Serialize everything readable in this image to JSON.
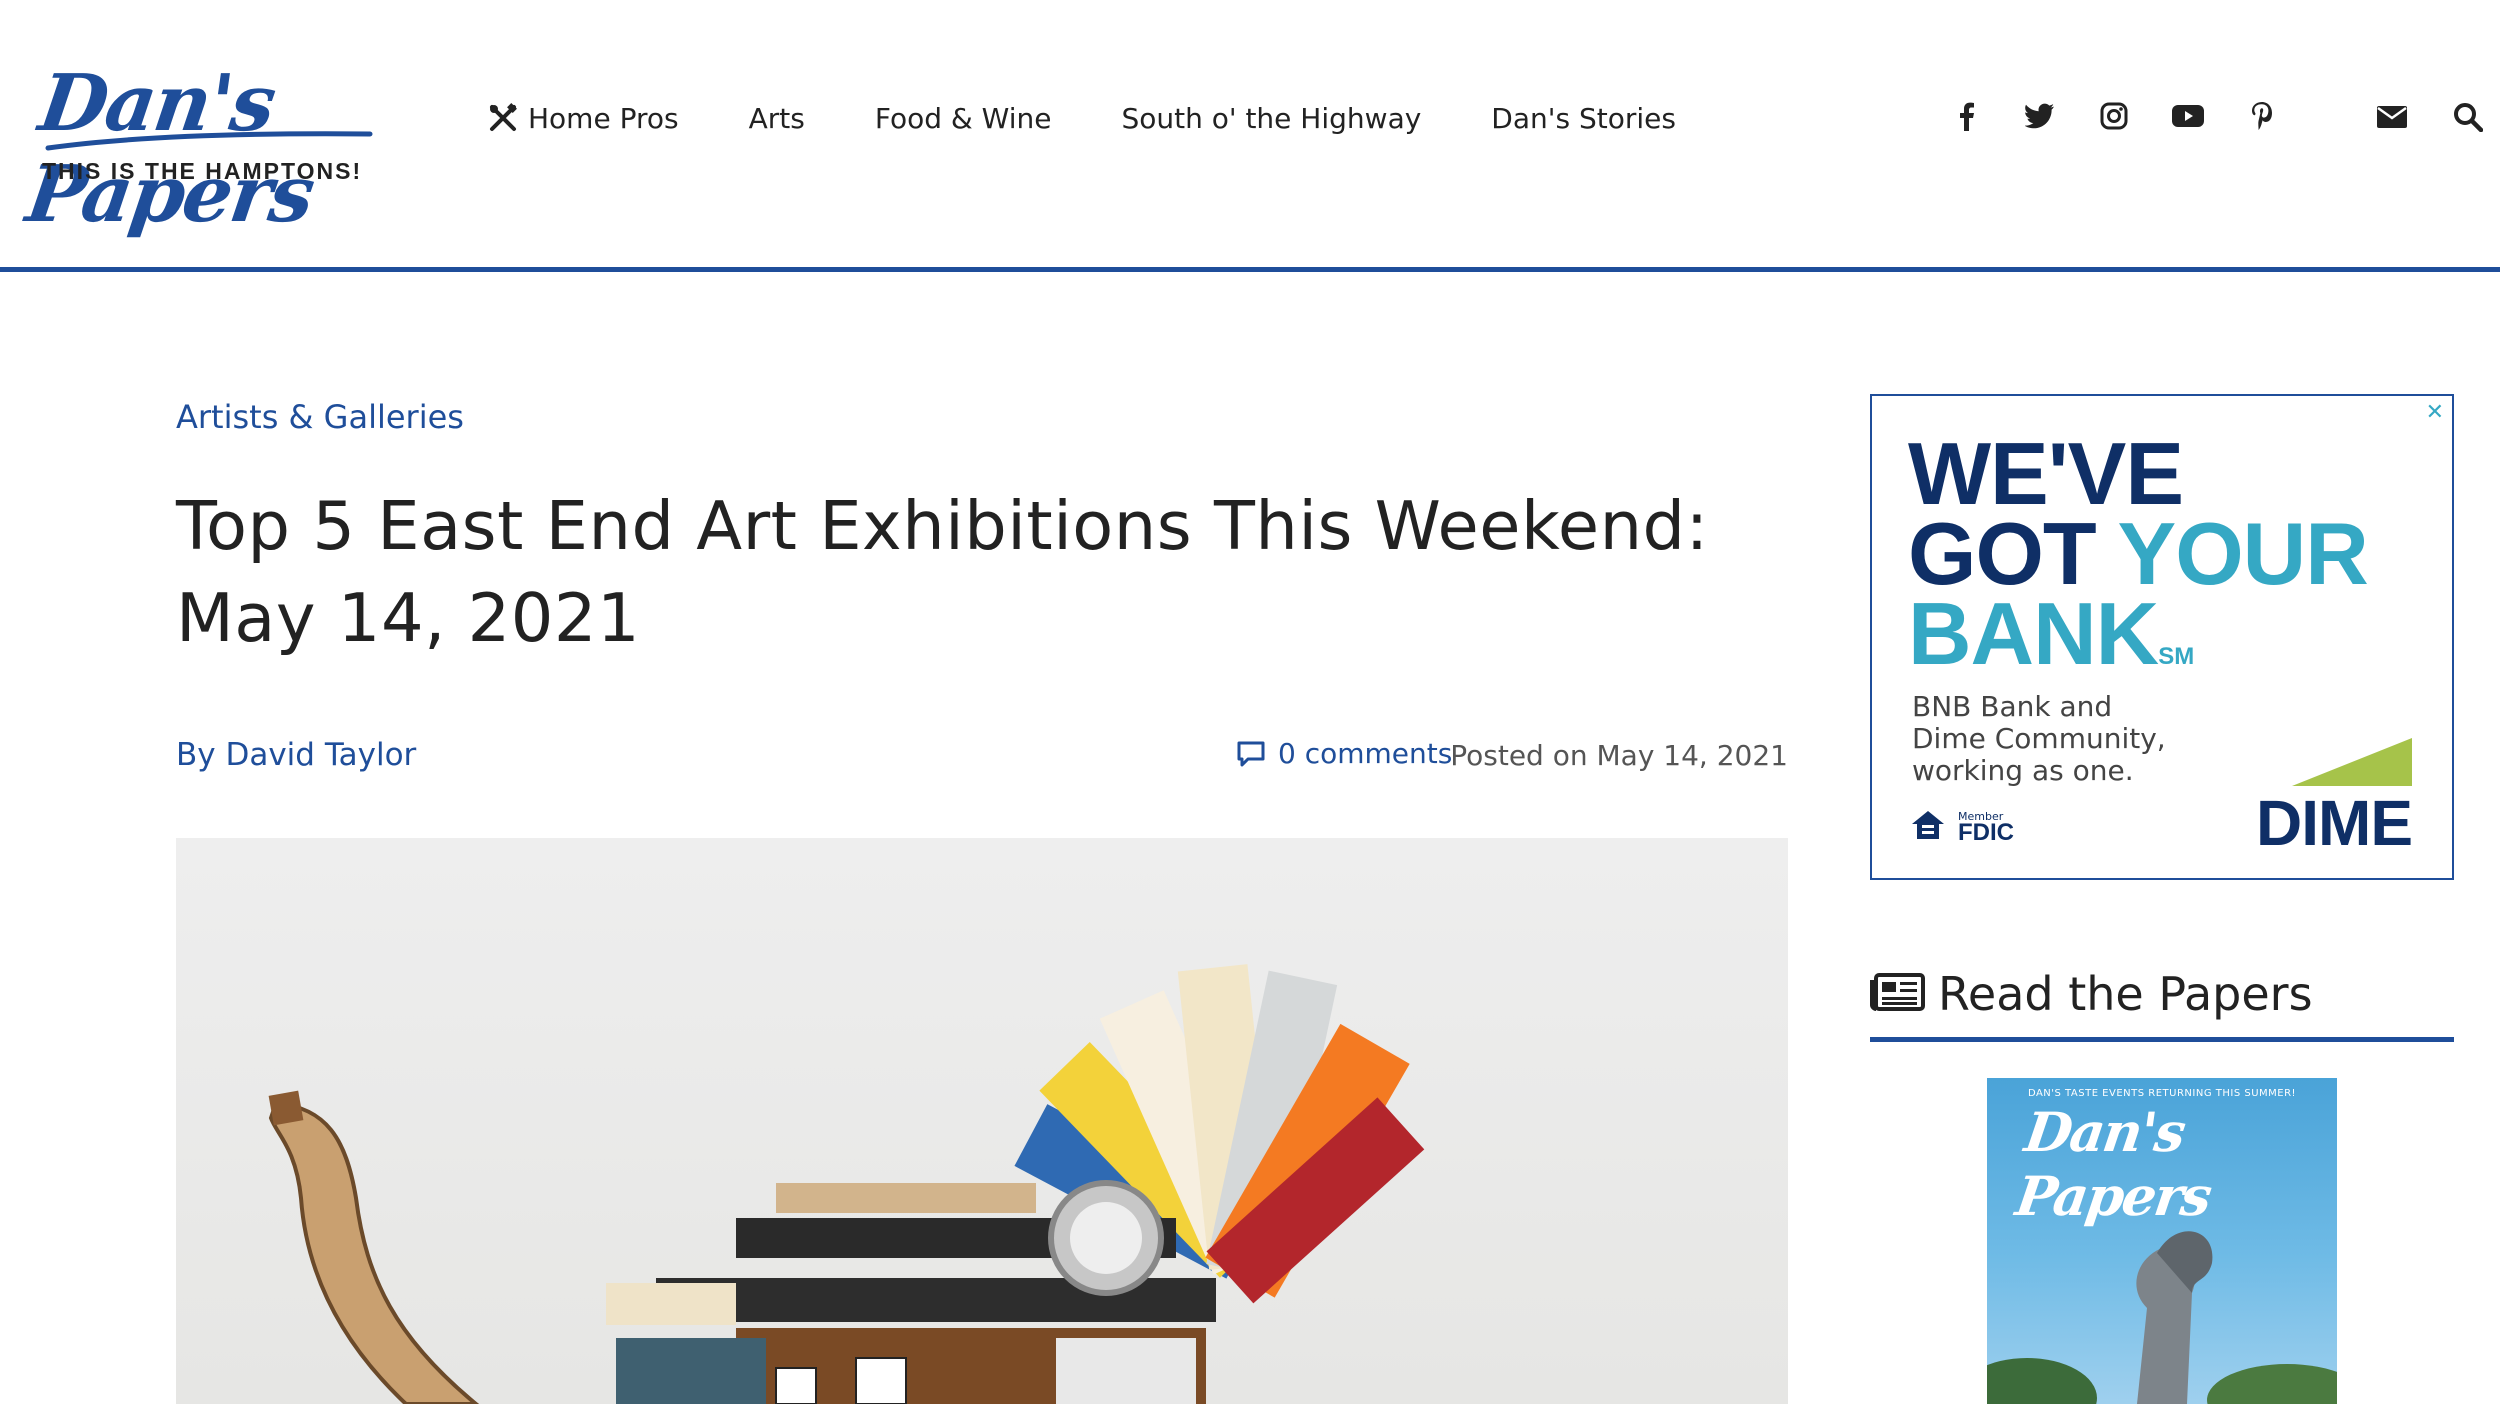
{
  "brand": {
    "logo_script": "Dan's Papers",
    "tagline": "THIS IS THE HAMPTONS!"
  },
  "nav": {
    "items": [
      {
        "label": "Home Pros",
        "icon": "tools-icon"
      },
      {
        "label": "Arts"
      },
      {
        "label": "Food & Wine"
      },
      {
        "label": "South o' the Highway"
      },
      {
        "label": "Dan's Stories"
      }
    ]
  },
  "social_icons": [
    "facebook-icon",
    "twitter-icon",
    "instagram-icon",
    "youtube-icon",
    "pinterest-icon"
  ],
  "utility_icons": [
    "envelope-icon",
    "search-icon"
  ],
  "article": {
    "category": "Artists & Galleries",
    "title": "Top 5 East End Art Exhibitions This Weekend: May 14, 2021",
    "author": "By David Taylor",
    "comments": "0 comments",
    "posted": "Posted on May 14, 2021"
  },
  "ad": {
    "close": "✕",
    "line1": "WE'VE",
    "line2a": "GOT",
    "line2b": "YOUR",
    "line3": "BANK",
    "sm": "SM",
    "sub": "BNB Bank and Dime Community, working as one.",
    "fdic_label": "FDIC",
    "member_label": "Member",
    "brand": "DIME"
  },
  "sidebar": {
    "read_title": "Read the Papers",
    "cover_top": "DAN'S TASTE EVENTS RETURNING THIS SUMMER!",
    "cover_logo": "Dan's Papers"
  },
  "colors": {
    "brand_blue": "#1f4e9a",
    "ad_navy": "#0f2f66",
    "ad_teal": "#35a8c4",
    "ad_green": "#a6c34a"
  }
}
